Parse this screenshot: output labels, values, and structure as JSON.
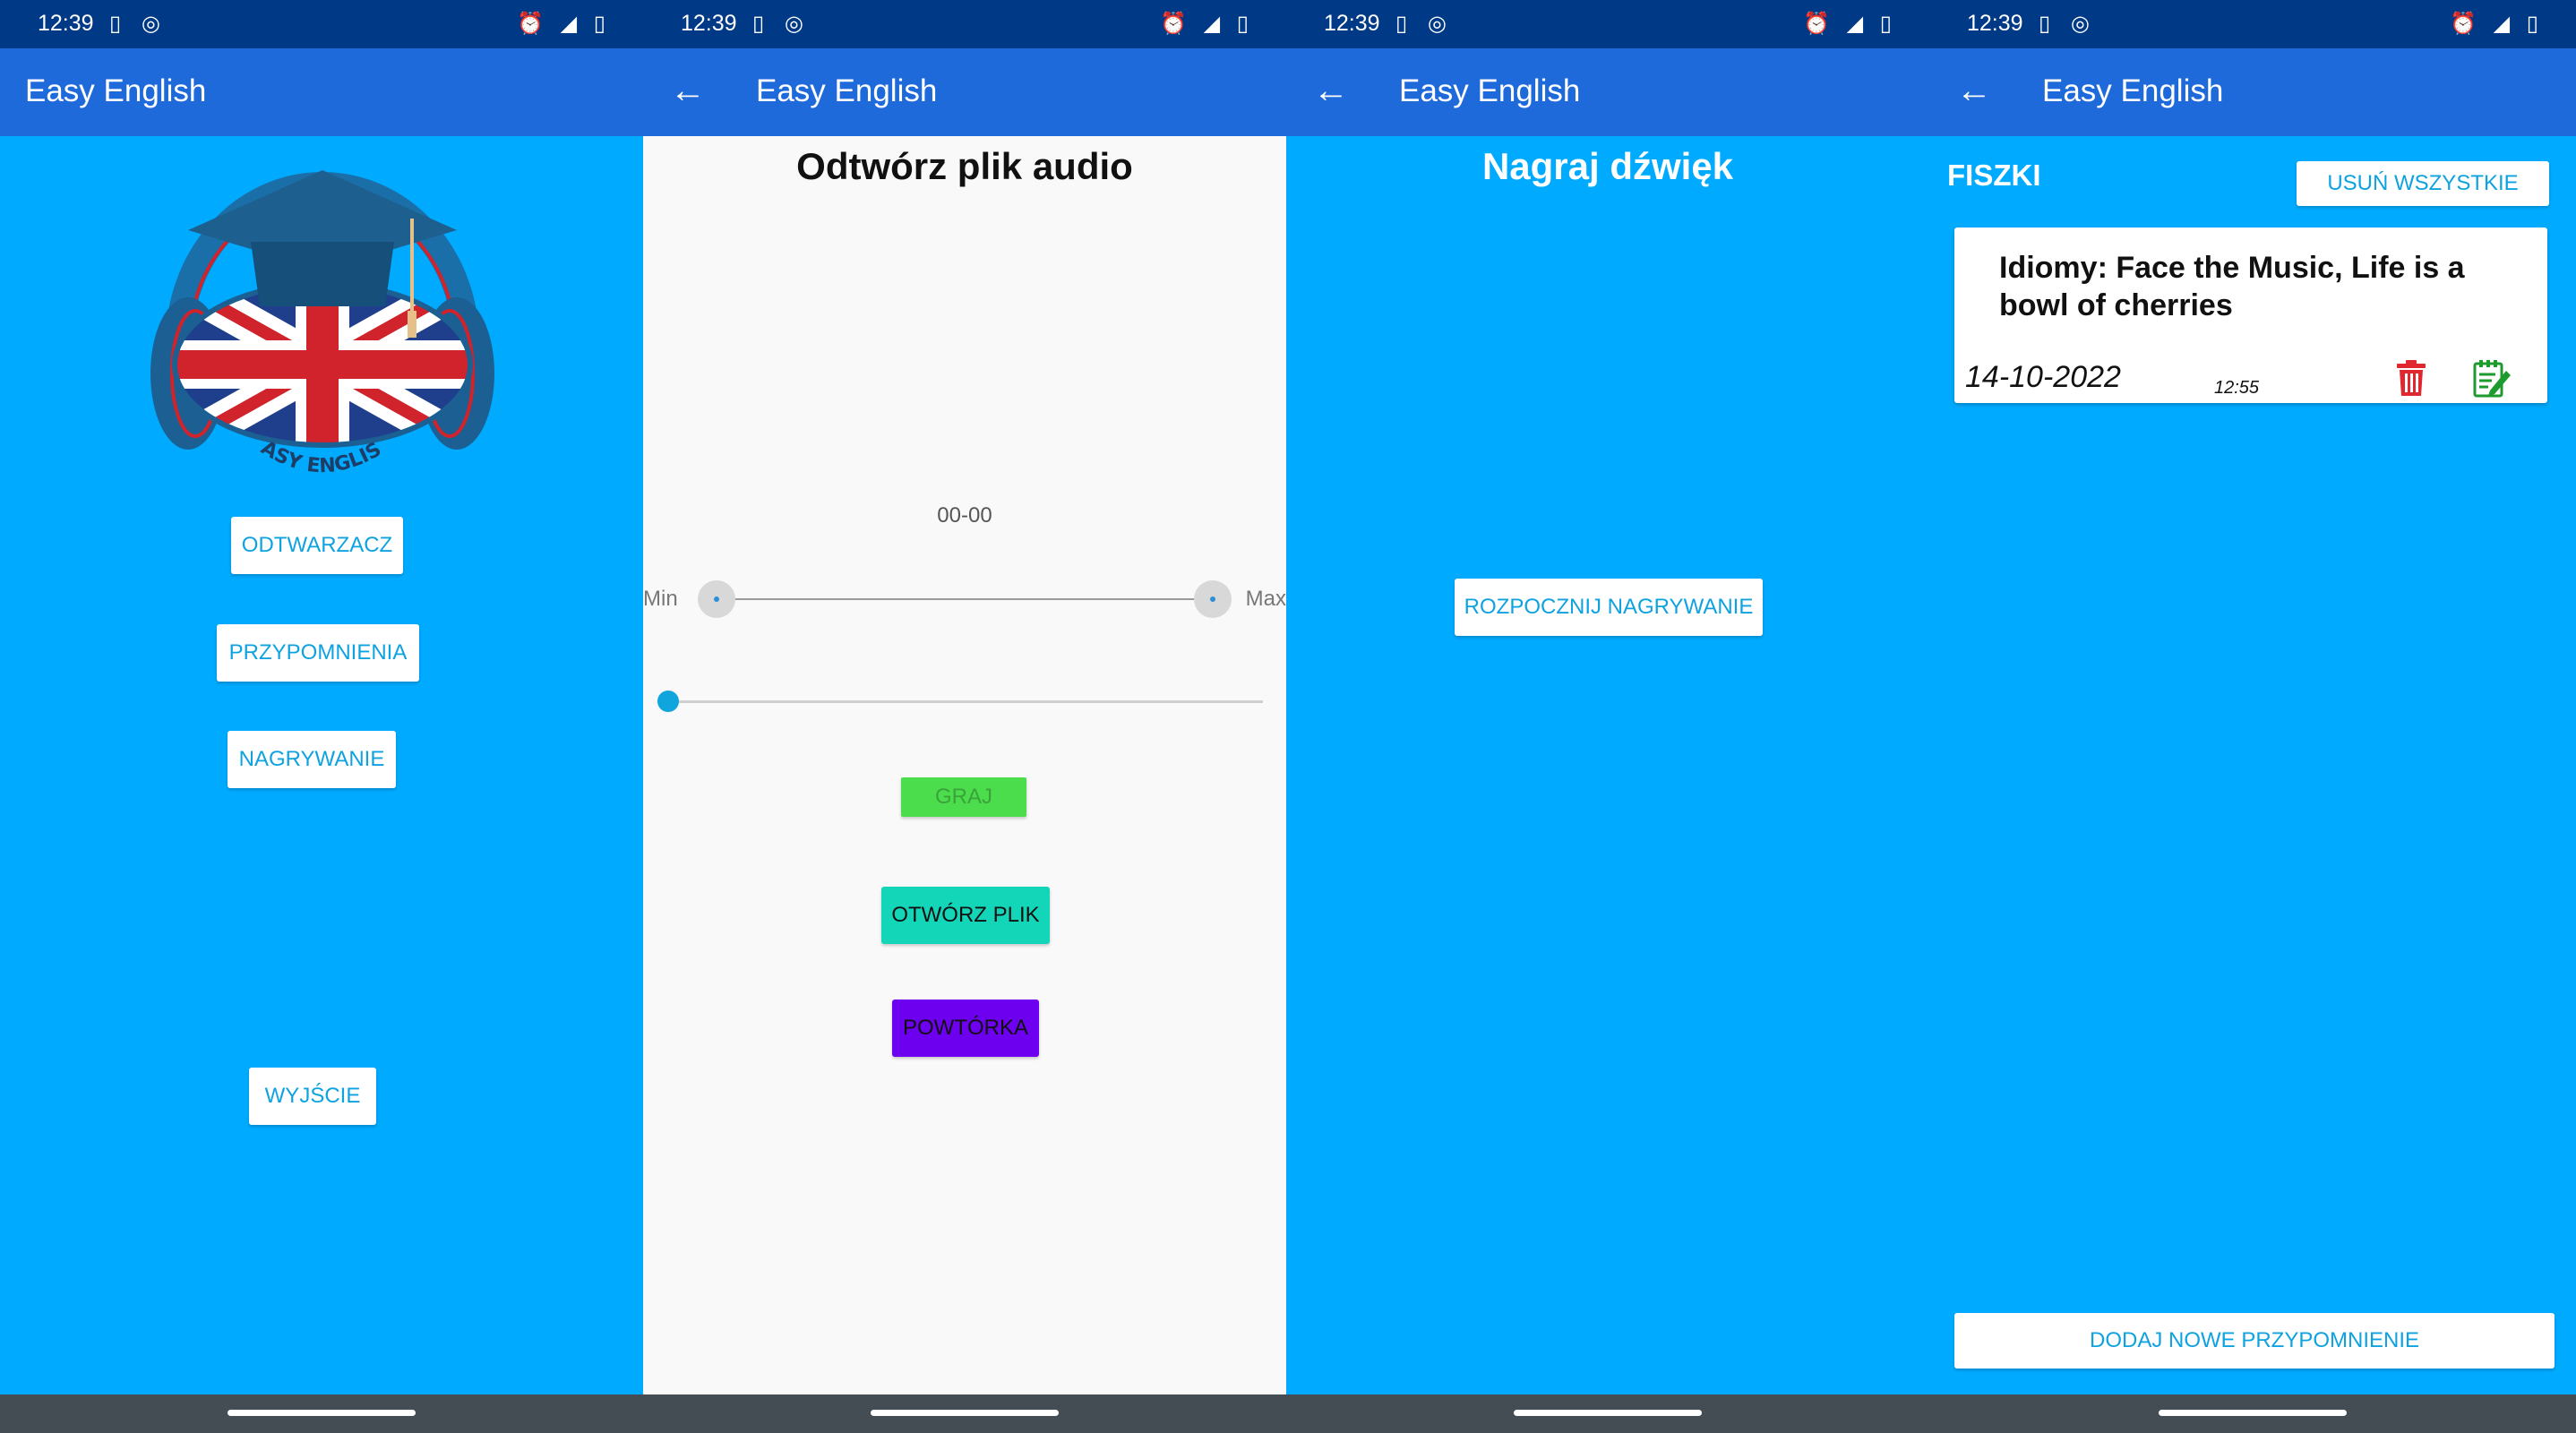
{
  "statusbar": {
    "time": "12:39",
    "left_icons": "▯ ◎",
    "right_icons": "⏰ ◢ ▯"
  },
  "app": {
    "title": "Easy English"
  },
  "home": {
    "logo_text": "EASY ENGLISH",
    "buttons": [
      "ODTWARZACZ",
      "PRZYPOMNIENIA",
      "NAGRYWANIE",
      "WYJŚCIE"
    ]
  },
  "player": {
    "heading": "Odtwórz plik audio",
    "timer": "00-00",
    "range_min_label": "Min",
    "range_max_label": "Max",
    "seek_progress": 0,
    "play_button": "GRAJ",
    "open_button": "OTWÓRZ PLIK",
    "repeat_button": "POWTÓRKA"
  },
  "recorder": {
    "heading": "Nagraj dźwięk",
    "record_button": "ROZPOCZNIJ NAGRYWANIE"
  },
  "flashcards": {
    "section_title": "FISZKI",
    "delete_all_button": "USUŃ WSZYSTKIE",
    "cards": [
      {
        "title": "Idiomy: Face the Music, Life is a bowl of cherries",
        "date": "14-10-2022",
        "time": "12:55"
      }
    ],
    "add_button": "DODAJ NOWE PRZYPOMNIENIE"
  },
  "colors": {
    "statusbar": "#003a86",
    "appbar": "#1f6adb",
    "background": "#00abff",
    "player_background": "#f9f9f9",
    "play_button": "#4cdd4c",
    "open_button": "#13d6b9",
    "repeat_button": "#6d00ee",
    "navbar": "#454d54"
  }
}
